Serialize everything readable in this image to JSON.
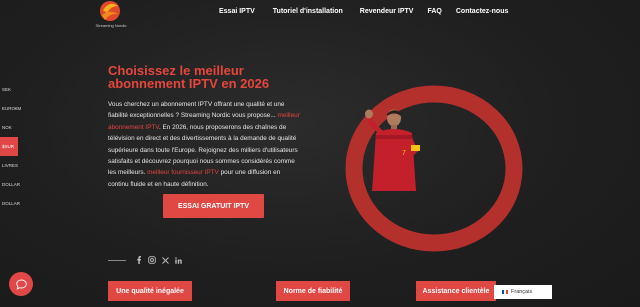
{
  "logo": {
    "text": "Streaming Nordic"
  },
  "nav": {
    "items": [
      "Essai IPTV",
      "Tutoriel d'installation",
      "Revendeur IPTV",
      "FAQ",
      "Contactez-nous"
    ]
  },
  "currency": {
    "items": [
      "SEK",
      "EURO€M",
      "NOK",
      "$SUR",
      "LIVRES",
      "DOLLAR",
      "DOLLAR"
    ],
    "active_index": 3
  },
  "hero": {
    "title": "Choisissez le meilleur abonnement IPTV en 2026",
    "p1": "Vous cherchez un abonnement IPTV offrant une qualité et une fiabilité exceptionnelles ? Streaming Nordic vous propose...",
    "p1_link": "meilleur abonnement IPTV",
    "p2": ". En 2026, nous proposerons des chaînes de télévision en direct et des divertissements à la demande de qualité supérieure dans toute l'Europe. Rejoignez des milliers d'utilisateurs satisfaits et découvrez pourquoi nous sommes considérés comme les meilleurs.",
    "p2_link": "meilleur fournisseur IPTV",
    "p3": " pour une diffusion en continu fluide et en haute définition.",
    "cta": "ESSAI GRATUIT IPTV"
  },
  "social": {
    "icons": [
      "facebook-icon",
      "instagram-icon",
      "x-icon",
      "linkedin-icon"
    ]
  },
  "features": [
    "Une qualité inégalée",
    "Norme de fiabilité",
    "Assistance clientèle"
  ],
  "language": {
    "label": "Français"
  },
  "colors": {
    "accent": "#e04843",
    "background": "#1f1f1f"
  }
}
